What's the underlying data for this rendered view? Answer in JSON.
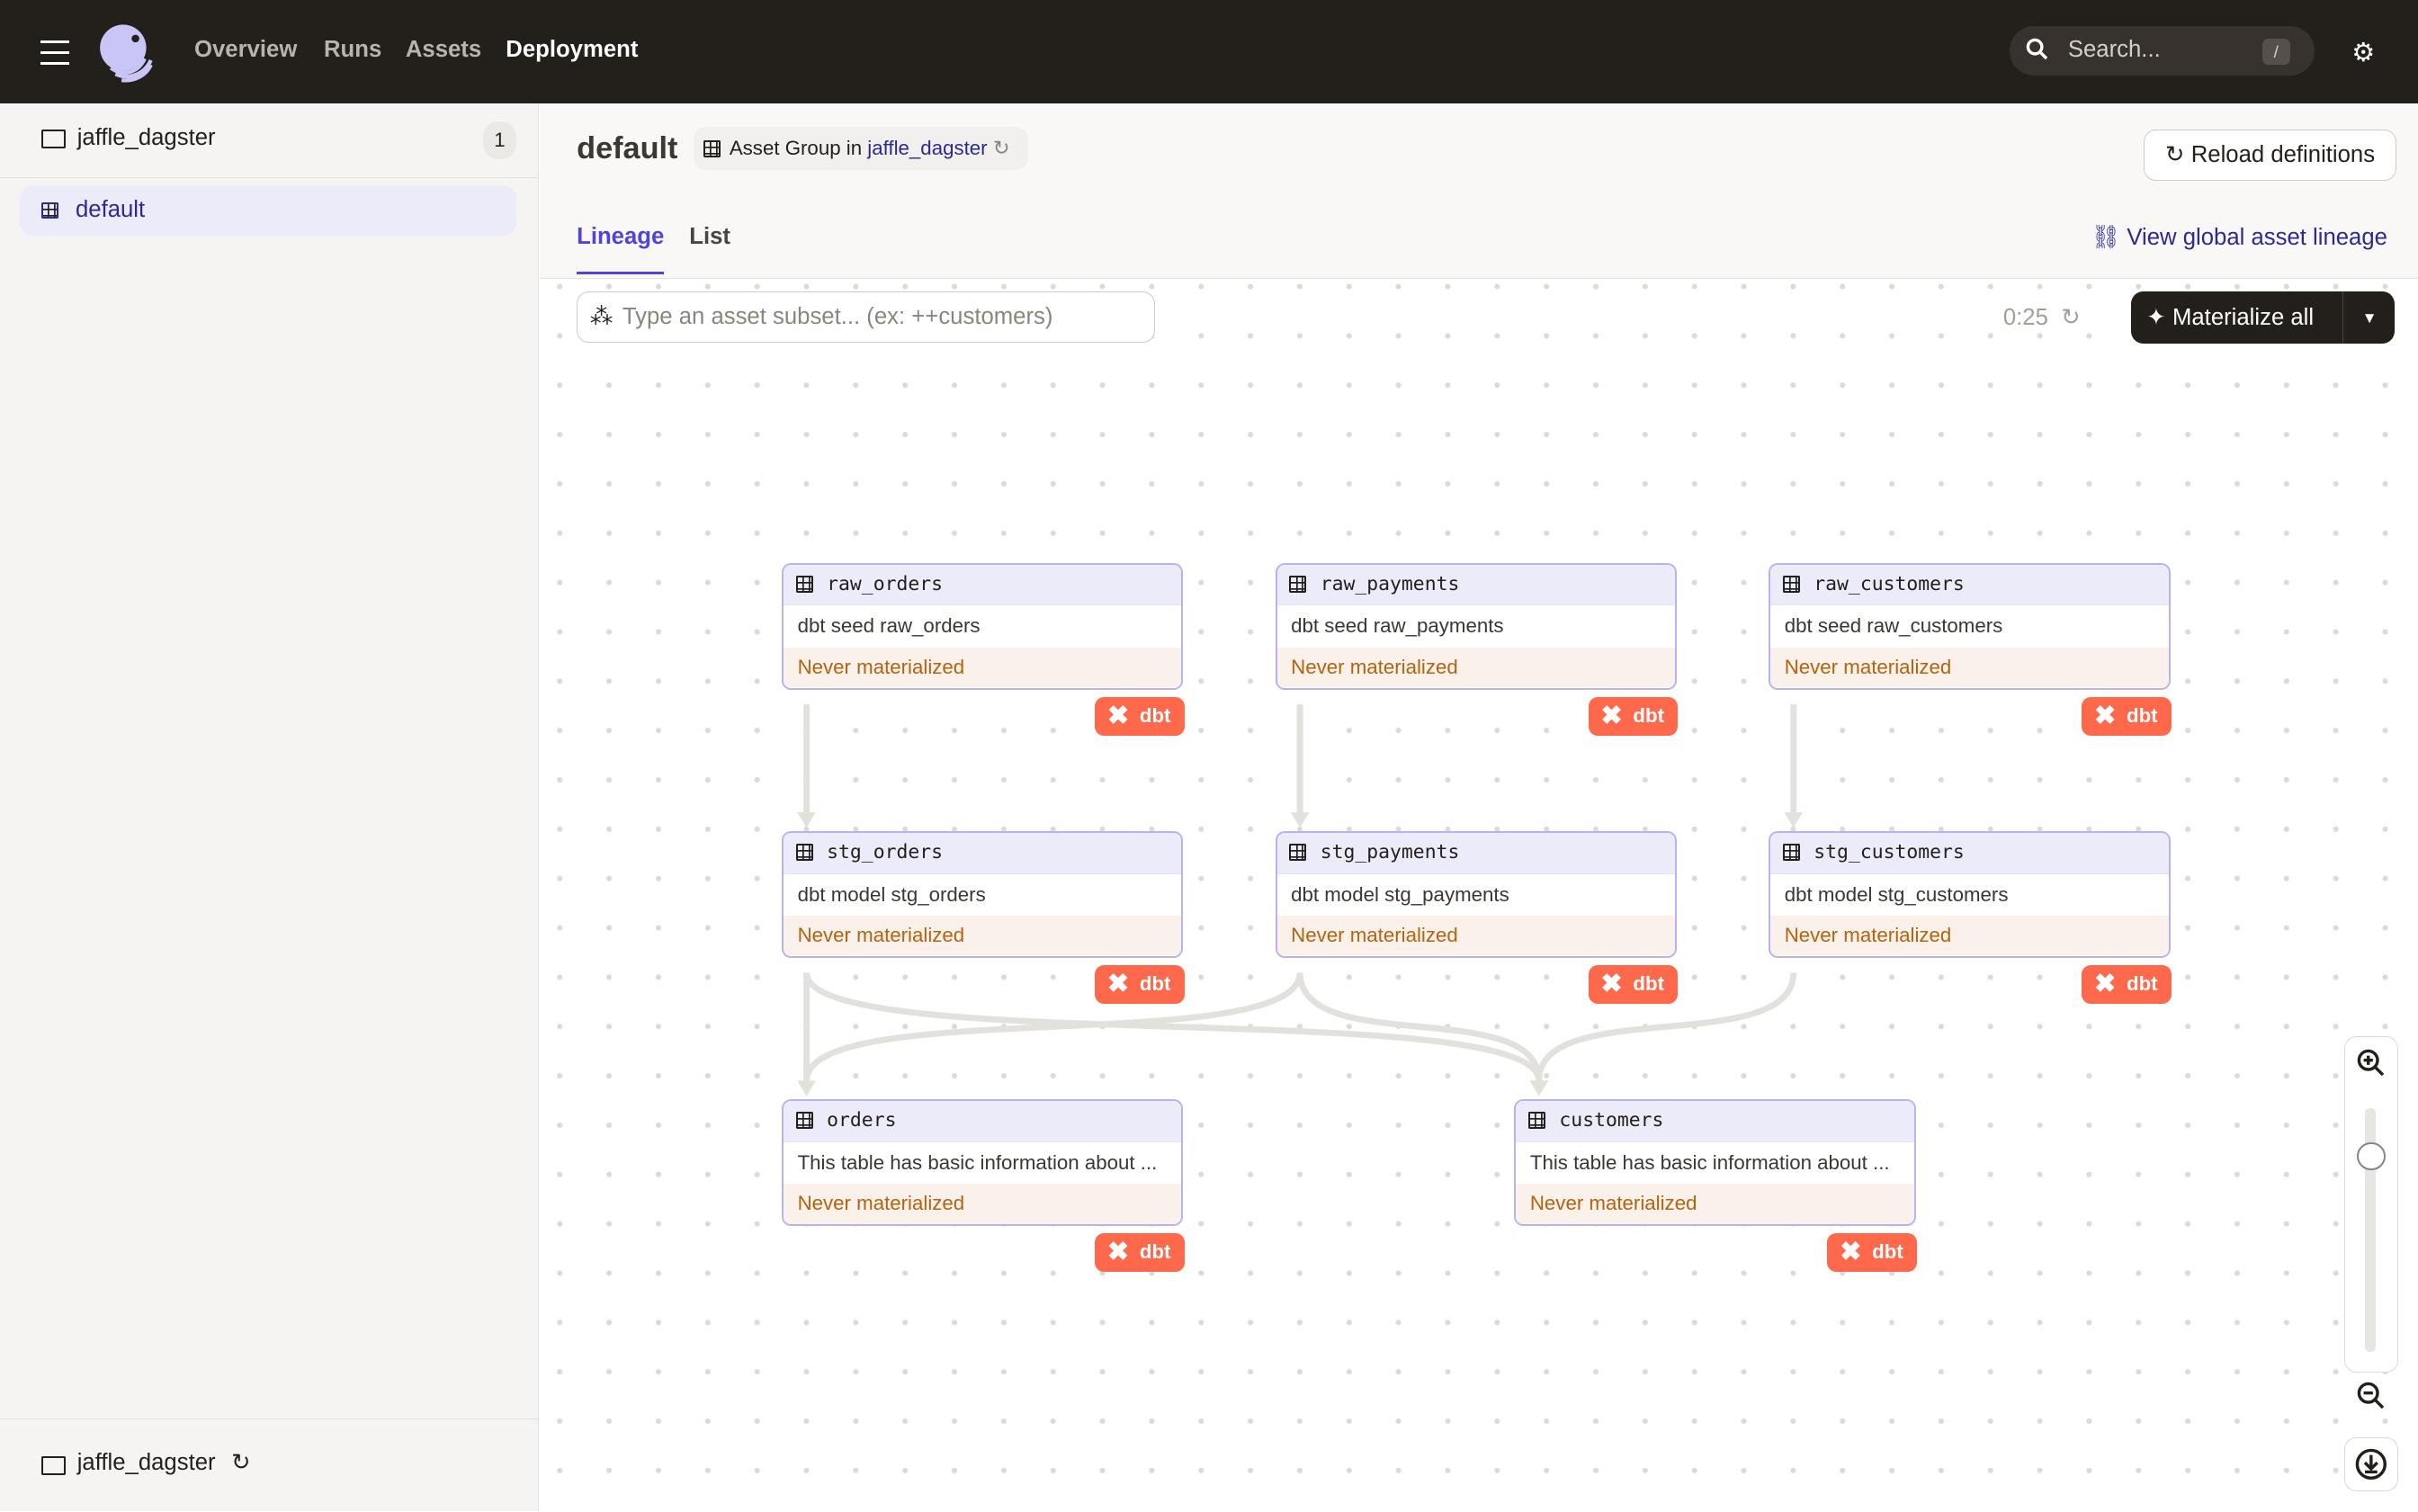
{
  "topbar": {
    "nav": [
      "Overview",
      "Runs",
      "Assets",
      "Deployment"
    ],
    "active": "Deployment",
    "search_placeholder": "Search...",
    "search_shortcut": "/"
  },
  "sidebar": {
    "repo": "jaffle_dagster",
    "repo_count": "1",
    "groups": [
      {
        "label": "default",
        "selected": true
      }
    ],
    "footer_repo": "jaffle_dagster"
  },
  "header": {
    "title": "default",
    "pill_prefix": "Asset Group in",
    "pill_link": "jaffle_dagster",
    "reload_label": "Reload definitions",
    "tabs": [
      "Lineage",
      "List"
    ],
    "active_tab": "Lineage",
    "global_lineage": "View global asset lineage"
  },
  "toolbar": {
    "subset_placeholder": "Type an asset subset... (ex: ++customers)",
    "timer": "0:25",
    "materialize_label": "Materialize all"
  },
  "colors": {
    "accent": "#4f43dd",
    "dbt": "#ff694b",
    "node_border": "#b6b3f5",
    "status": "#b5630f"
  },
  "nodes": [
    {
      "name": "raw_orders",
      "desc": "dbt seed raw_orders",
      "status": "Never materialized",
      "badge": "dbt"
    },
    {
      "name": "raw_payments",
      "desc": "dbt seed raw_payments",
      "status": "Never materialized",
      "badge": "dbt"
    },
    {
      "name": "raw_customers",
      "desc": "dbt seed raw_customers",
      "status": "Never materialized",
      "badge": "dbt"
    },
    {
      "name": "stg_orders",
      "desc": "dbt model stg_orders",
      "status": "Never materialized",
      "badge": "dbt"
    },
    {
      "name": "stg_payments",
      "desc": "dbt model stg_payments",
      "status": "Never materialized",
      "badge": "dbt"
    },
    {
      "name": "stg_customers",
      "desc": "dbt model stg_customers",
      "status": "Never materialized",
      "badge": "dbt"
    },
    {
      "name": "orders",
      "desc": "This table has basic information about ...",
      "status": "Never materialized",
      "badge": "dbt"
    },
    {
      "name": "customers",
      "desc": "This table has basic information about ...",
      "status": "Never materialized",
      "badge": "dbt"
    }
  ],
  "edges": [
    [
      "raw_orders",
      "stg_orders"
    ],
    [
      "raw_payments",
      "stg_payments"
    ],
    [
      "raw_customers",
      "stg_customers"
    ],
    [
      "stg_orders",
      "orders"
    ],
    [
      "stg_orders",
      "customers"
    ],
    [
      "stg_payments",
      "orders"
    ],
    [
      "stg_payments",
      "customers"
    ],
    [
      "stg_customers",
      "customers"
    ]
  ]
}
